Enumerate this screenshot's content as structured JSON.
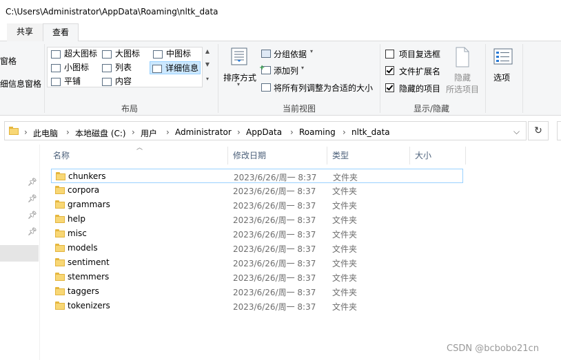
{
  "window": {
    "title": "C:\\Users\\Administrator\\AppData\\Roaming\\nltk_data"
  },
  "tabs": {
    "share": "共享",
    "view": "查看"
  },
  "ribbon": {
    "panes": {
      "nav_pane": "窗格",
      "details_pane": "细信息窗格"
    },
    "layout": {
      "items": [
        "超大图标",
        "大图标",
        "中图标",
        "小图标",
        "列表",
        "详细信息",
        "平铺",
        "内容"
      ],
      "selected": "详细信息",
      "label": "布局"
    },
    "current_view": {
      "sort_by": "排序方式",
      "group_by": "分组依据",
      "add_column": "添加列",
      "fit_columns": "将所有列调整为合适的大小",
      "label": "当前视图"
    },
    "show_hide": {
      "item_checkboxes": "项目复选框",
      "item_checkboxes_checked": false,
      "file_extensions": "文件扩展名",
      "file_extensions_checked": true,
      "hidden_items": "隐藏的项目",
      "hidden_items_checked": true,
      "hide": "隐藏",
      "selected_items": "所选项目",
      "label": "显示/隐藏"
    },
    "options": "选项"
  },
  "address": {
    "crumbs": [
      "此电脑",
      "本地磁盘 (C:)",
      "用户",
      "Administrator",
      "AppData",
      "Roaming",
      "nltk_data"
    ]
  },
  "columns": {
    "name": "名称",
    "modified": "修改日期",
    "type": "类型",
    "size": "大小"
  },
  "files": [
    {
      "name": "chunkers",
      "modified": "2023/6/26/周一 8:37",
      "type": "文件夹"
    },
    {
      "name": "corpora",
      "modified": "2023/6/26/周一 8:37",
      "type": "文件夹"
    },
    {
      "name": "grammars",
      "modified": "2023/6/26/周一 8:37",
      "type": "文件夹"
    },
    {
      "name": "help",
      "modified": "2023/6/26/周一 8:37",
      "type": "文件夹"
    },
    {
      "name": "misc",
      "modified": "2023/6/26/周一 8:37",
      "type": "文件夹"
    },
    {
      "name": "models",
      "modified": "2023/6/26/周一 8:37",
      "type": "文件夹"
    },
    {
      "name": "sentiment",
      "modified": "2023/6/26/周一 8:37",
      "type": "文件夹"
    },
    {
      "name": "stemmers",
      "modified": "2023/6/26/周一 8:37",
      "type": "文件夹"
    },
    {
      "name": "taggers",
      "modified": "2023/6/26/周一 8:37",
      "type": "文件夹"
    },
    {
      "name": "tokenizers",
      "modified": "2023/6/26/周一 8:37",
      "type": "文件夹"
    }
  ],
  "watermark": "CSDN @bcbobo21cn",
  "colors": {
    "folder": "#f8d775",
    "selection": "#cce8ff",
    "header_text": "#4c607a"
  }
}
